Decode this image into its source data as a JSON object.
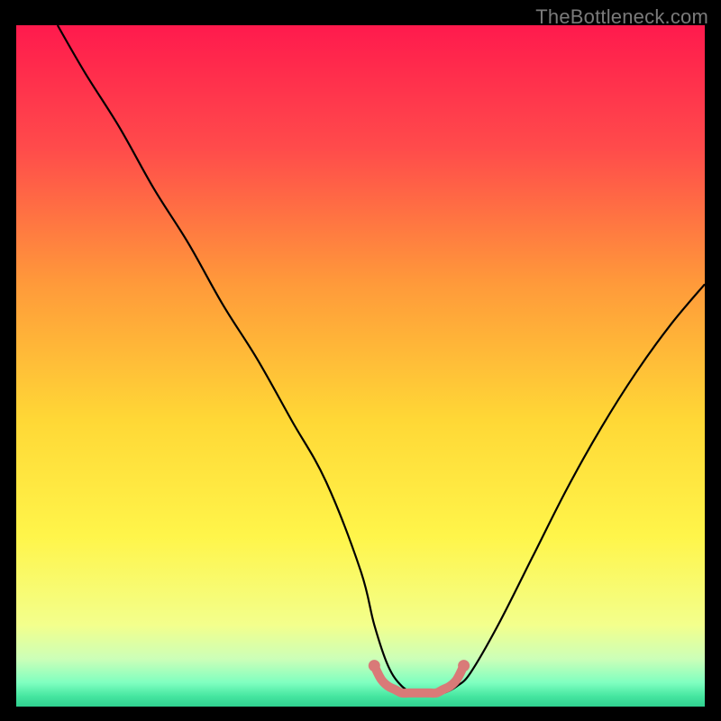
{
  "watermark": "TheBottleneck.com",
  "chart_data": {
    "type": "line",
    "title": "",
    "xlabel": "",
    "ylabel": "",
    "xlim": [
      0,
      100
    ],
    "ylim": [
      0,
      100
    ],
    "grid": false,
    "legend": false,
    "annotations": [],
    "background_gradient_stops": [
      {
        "stop": 0.0,
        "color": "#ff1a4d"
      },
      {
        "stop": 0.18,
        "color": "#ff4b4b"
      },
      {
        "stop": 0.38,
        "color": "#ff9a3a"
      },
      {
        "stop": 0.58,
        "color": "#ffd836"
      },
      {
        "stop": 0.75,
        "color": "#fff54a"
      },
      {
        "stop": 0.88,
        "color": "#f3ff8c"
      },
      {
        "stop": 0.93,
        "color": "#ccffb8"
      },
      {
        "stop": 0.965,
        "color": "#7fffc0"
      },
      {
        "stop": 0.985,
        "color": "#45e6a0"
      },
      {
        "stop": 1.0,
        "color": "#2fcf8f"
      }
    ],
    "series": [
      {
        "name": "bottleneck-curve",
        "color": "#000000",
        "x": [
          6,
          10,
          15,
          20,
          25,
          30,
          35,
          40,
          45,
          50,
          52,
          54,
          56,
          58,
          60,
          62,
          64,
          66,
          70,
          75,
          80,
          85,
          90,
          95,
          100
        ],
        "y": [
          100,
          93,
          85,
          76,
          68,
          59,
          51,
          42,
          33,
          20,
          12,
          6,
          3,
          2,
          2,
          2,
          3,
          5,
          12,
          22,
          32,
          41,
          49,
          56,
          62
        ]
      },
      {
        "name": "optimal-zone-marker",
        "color": "#d97a78",
        "x": [
          52,
          53,
          54,
          55,
          56,
          57,
          58,
          59,
          60,
          61,
          62,
          63,
          64,
          65
        ],
        "y": [
          6,
          4,
          3,
          2.5,
          2,
          2,
          2,
          2,
          2,
          2,
          2.5,
          3,
          4,
          6
        ]
      }
    ]
  }
}
